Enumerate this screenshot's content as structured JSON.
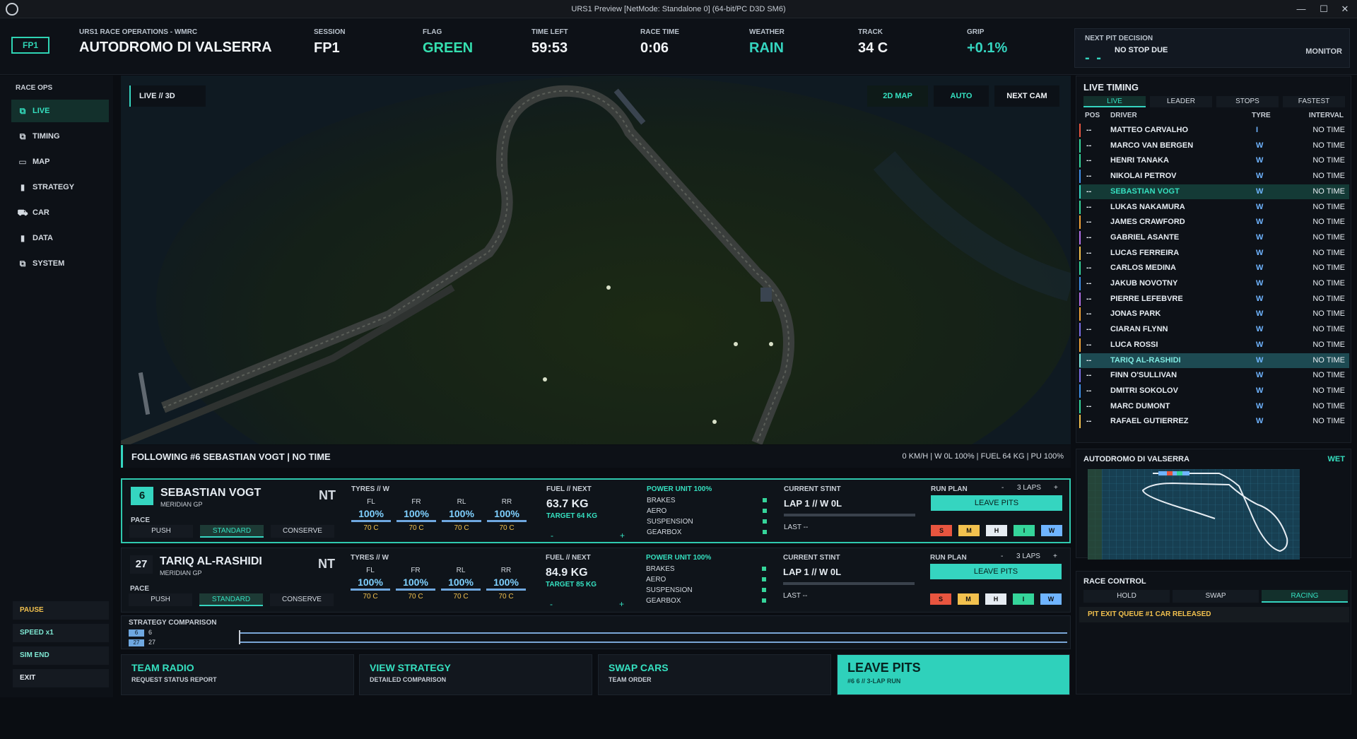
{
  "window": {
    "title": "URS1 Preview [NetMode: Standalone 0]  (64-bit/PC D3D SM6)",
    "min": "—",
    "max": "☐",
    "close": "✕"
  },
  "header": {
    "badge": "FP1",
    "subtitle": "URS1 RACE OPERATIONS - WMRC",
    "track_name": "AUTODROMO DI VALSERRA",
    "stats": [
      {
        "label": "SESSION",
        "value": "FP1"
      },
      {
        "label": "FLAG",
        "value": "GREEN"
      },
      {
        "label": "TIME LEFT",
        "value": "59:53"
      },
      {
        "label": "RACE TIME",
        "value": "0:06"
      },
      {
        "label": "WEATHER",
        "value": "RAIN"
      },
      {
        "label": "TRACK",
        "value": "34 C"
      },
      {
        "label": "GRIP",
        "value": "+0.1%"
      }
    ],
    "pit": {
      "label": "NEXT PIT DECISION",
      "dash": "- -",
      "text": "NO STOP DUE",
      "monitor": "MONITOR"
    }
  },
  "nav": {
    "title": "RACE OPS",
    "items": [
      {
        "label": "LIVE",
        "icon": "⧉"
      },
      {
        "label": "TIMING",
        "icon": "⧉"
      },
      {
        "label": "MAP",
        "icon": "▭"
      },
      {
        "label": "STRATEGY",
        "icon": "▮"
      },
      {
        "label": "CAR",
        "icon": "⛟"
      },
      {
        "label": "DATA",
        "icon": "▮"
      },
      {
        "label": "SYSTEM",
        "icon": "⧉"
      }
    ],
    "controls": [
      "PAUSE",
      "SPEED x1",
      "SIM END",
      "EXIT"
    ]
  },
  "viewport": {
    "mode": "LIVE  //  3D",
    "buttons": [
      "2D MAP",
      "AUTO",
      "NEXT CAM"
    ]
  },
  "following": {
    "text": "FOLLOWING   #6  SEBASTIAN VOGT   |   NO TIME",
    "telemetry": "0 KM/H   |   W 0L  100%   |   FUEL 64 KG   |   PU 100%"
  },
  "cars": [
    {
      "number": "6",
      "driver": "SEBASTIAN VOGT",
      "team": "MERIDIAN GP",
      "time": "NT",
      "pace_label": "PACE",
      "pace": [
        "PUSH",
        "STANDARD",
        "CONSERVE"
      ],
      "tyres_label": "TYRES  //  W",
      "tyres": [
        {
          "pos": "FL",
          "pct": "100%",
          "temp": "70 C"
        },
        {
          "pos": "FR",
          "pct": "100%",
          "temp": "70 C"
        },
        {
          "pos": "RL",
          "pct": "100%",
          "temp": "70 C"
        },
        {
          "pos": "RR",
          "pct": "100%",
          "temp": "70 C"
        }
      ],
      "fuel_label": "FUEL  //  NEXT",
      "fuel": "63.7 KG",
      "target": "TARGET 64 KG",
      "pu": "POWER UNIT  100%",
      "components": [
        "BRAKES",
        "AERO",
        "SUSPENSION",
        "GEARBOX"
      ],
      "stint_label": "CURRENT STINT",
      "lap": "LAP 1   //   W 0L",
      "last": "LAST --",
      "plan_label": "RUN PLAN",
      "laps": "3 LAPS",
      "leave": "LEAVE PITS",
      "compounds": [
        "S",
        "M",
        "H",
        "I",
        "W"
      ]
    },
    {
      "number": "27",
      "driver": "TARIQ AL-RASHIDI",
      "team": "MERIDIAN GP",
      "time": "NT",
      "pace_label": "PACE",
      "pace": [
        "PUSH",
        "STANDARD",
        "CONSERVE"
      ],
      "tyres_label": "TYRES  //  W",
      "tyres": [
        {
          "pos": "FL",
          "pct": "100%",
          "temp": "70 C"
        },
        {
          "pos": "FR",
          "pct": "100%",
          "temp": "70 C"
        },
        {
          "pos": "RL",
          "pct": "100%",
          "temp": "70 C"
        },
        {
          "pos": "RR",
          "pct": "100%",
          "temp": "70 C"
        }
      ],
      "fuel_label": "FUEL  //  NEXT",
      "fuel": "84.9 KG",
      "target": "TARGET 85 KG",
      "pu": "POWER UNIT  100%",
      "components": [
        "BRAKES",
        "AERO",
        "SUSPENSION",
        "GEARBOX"
      ],
      "stint_label": "CURRENT STINT",
      "lap": "LAP 1   //   W 0L",
      "last": "LAST --",
      "plan_label": "RUN PLAN",
      "laps": "3 LAPS",
      "leave": "LEAVE PITS",
      "compounds": [
        "S",
        "M",
        "H",
        "I",
        "W"
      ]
    }
  ],
  "strategy": {
    "title": "STRATEGY COMPARISON",
    "rows": [
      {
        "chip": "6",
        "label": "6"
      },
      {
        "chip": "27",
        "label": "27"
      }
    ]
  },
  "actions": [
    {
      "title": "TEAM RADIO",
      "sub": "REQUEST STATUS REPORT"
    },
    {
      "title": "VIEW STRATEGY",
      "sub": "DETAILED COMPARISON"
    },
    {
      "title": "SWAP CARS",
      "sub": "TEAM ORDER"
    },
    {
      "title": "LEAVE PITS",
      "sub": "#6 6  //  3-LAP RUN"
    }
  ],
  "timing": {
    "title": "LIVE TIMING",
    "tabs": [
      "LIVE",
      "LEADER",
      "STOPS",
      "FASTEST"
    ],
    "headers": [
      "POS",
      "DRIVER",
      "TYRE",
      "INTERVAL"
    ],
    "rows": [
      {
        "pos": "--",
        "driver": "MATTEO CARVALHO",
        "tyre": "I",
        "interval": "NO TIME",
        "color": "#e8553f"
      },
      {
        "pos": "--",
        "driver": "MARCO VAN BERGEN",
        "tyre": "W",
        "interval": "NO TIME",
        "color": "#35d59a"
      },
      {
        "pos": "--",
        "driver": "HENRI TANAKA",
        "tyre": "W",
        "interval": "NO TIME",
        "color": "#35d59a"
      },
      {
        "pos": "--",
        "driver": "NIKOLAI PETROV",
        "tyre": "W",
        "interval": "NO TIME",
        "color": "#3f8fe8"
      },
      {
        "pos": "--",
        "driver": "SEBASTIAN VOGT",
        "tyre": "W",
        "interval": "NO TIME",
        "color": "#35d5c0"
      },
      {
        "pos": "--",
        "driver": "LUKAS NAKAMURA",
        "tyre": "W",
        "interval": "NO TIME",
        "color": "#35d59a"
      },
      {
        "pos": "--",
        "driver": "JAMES CRAWFORD",
        "tyre": "W",
        "interval": "NO TIME",
        "color": "#f2a43a"
      },
      {
        "pos": "--",
        "driver": "GABRIEL ASANTE",
        "tyre": "W",
        "interval": "NO TIME",
        "color": "#b36fe8"
      },
      {
        "pos": "--",
        "driver": "LUCAS FERREIRA",
        "tyre": "W",
        "interval": "NO TIME",
        "color": "#f2c14e"
      },
      {
        "pos": "--",
        "driver": "CARLOS MEDINA",
        "tyre": "W",
        "interval": "NO TIME",
        "color": "#35d59a"
      },
      {
        "pos": "--",
        "driver": "JAKUB NOVOTNY",
        "tyre": "W",
        "interval": "NO TIME",
        "color": "#3f8fe8"
      },
      {
        "pos": "--",
        "driver": "PIERRE LEFEBVRE",
        "tyre": "W",
        "interval": "NO TIME",
        "color": "#b36fe8"
      },
      {
        "pos": "--",
        "driver": "JONAS PARK",
        "tyre": "W",
        "interval": "NO TIME",
        "color": "#f2a43a"
      },
      {
        "pos": "--",
        "driver": "CIARAN FLYNN",
        "tyre": "W",
        "interval": "NO TIME",
        "color": "#7c6fe8"
      },
      {
        "pos": "--",
        "driver": "LUCA ROSSI",
        "tyre": "W",
        "interval": "NO TIME",
        "color": "#f2a43a"
      },
      {
        "pos": "--",
        "driver": "TARIQ AL-RASHIDI",
        "tyre": "W",
        "interval": "NO TIME",
        "color": "#7fe8e0"
      },
      {
        "pos": "--",
        "driver": "FINN O'SULLIVAN",
        "tyre": "W",
        "interval": "NO TIME",
        "color": "#7c6fe8"
      },
      {
        "pos": "--",
        "driver": "DMITRI SOKOLOV",
        "tyre": "W",
        "interval": "NO TIME",
        "color": "#3f8fe8"
      },
      {
        "pos": "--",
        "driver": "MARC DUMONT",
        "tyre": "W",
        "interval": "NO TIME",
        "color": "#35d59a"
      },
      {
        "pos": "--",
        "driver": "RAFAEL GUTIERREZ",
        "tyre": "W",
        "interval": "NO TIME",
        "color": "#f2c14e"
      }
    ]
  },
  "minimap": {
    "title": "AUTODROMO DI VALSERRA",
    "condition": "WET"
  },
  "race_control": {
    "title": "RACE CONTROL",
    "buttons": [
      "HOLD",
      "SWAP",
      "RACING"
    ],
    "queue": "PIT EXIT QUEUE   #1 CAR RELEASED"
  },
  "colors": {
    "accent": "#35d5c0",
    "green_flag": "#35e0b0",
    "warning": "#f2c14e",
    "tyre_wet": "#6fb4ff"
  }
}
